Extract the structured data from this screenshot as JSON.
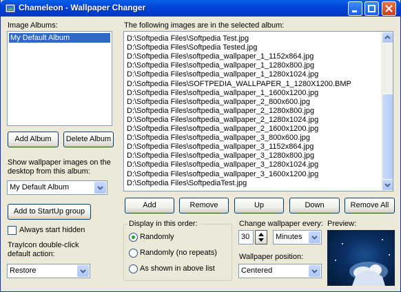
{
  "window": {
    "title": "Chameleon - Wallpaper Changer"
  },
  "left": {
    "albums_label": "Image Albums:",
    "albums": [
      "My Default Album"
    ],
    "add_album": "Add Album",
    "delete_album": "Delete Album",
    "show_label_1": "Show wallpaper images on the",
    "show_label_2": "desktop from this album:",
    "album_select": "My Default Album",
    "startup_btn": "Add to StartUp group",
    "always_hidden": "Always start hidden",
    "trayicon_label_1": "TrayIcon double-click",
    "trayicon_label_2": "default action:",
    "tray_action": "Restore"
  },
  "images": {
    "label": "The following images are in the selected album:",
    "files": [
      "D:\\Softpedia Files\\Softpedia Test.jpg",
      "D:\\Softpedia Files\\Softpedia Tested.jpg",
      "D:\\Softpedia Files\\softpedia_wallpaper_1_1152x864.jpg",
      "D:\\Softpedia Files\\softpedia_wallpaper_1_1280x800.jpg",
      "D:\\Softpedia Files\\softpedia_wallpaper_1_1280x1024.jpg",
      "D:\\Softpedia Files\\SOFTPEDIA_WALLPAPER_1_1280X1200.BMP",
      "D:\\Softpedia Files\\softpedia_wallpaper_1_1600x1200.jpg",
      "D:\\Softpedia Files\\softpedia_wallpaper_2_800x600.jpg",
      "D:\\Softpedia Files\\softpedia_wallpaper_2_1280x800.jpg",
      "D:\\Softpedia Files\\softpedia_wallpaper_2_1280x1024.jpg",
      "D:\\Softpedia Files\\softpedia_wallpaper_2_1600x1200.jpg",
      "D:\\Softpedia Files\\softpedia_wallpaper_3_800x600.jpg",
      "D:\\Softpedia Files\\softpedia_wallpaper_3_1152x864.jpg",
      "D:\\Softpedia Files\\softpedia_wallpaper_3_1280x800.jpg",
      "D:\\Softpedia Files\\softpedia_wallpaper_3_1280x1024.jpg",
      "D:\\Softpedia Files\\softpedia_wallpaper_3_1600x1200.jpg",
      "D:\\Softpedia Files\\SoftpediaTest.jpg"
    ],
    "add": "Add",
    "remove": "Remove",
    "up": "Up",
    "down": "Down",
    "remove_all": "Remove All"
  },
  "order": {
    "label": "Display in this order:",
    "options": [
      "Randomly",
      "Randomly (no repeats)",
      "As shown in above list"
    ],
    "selected": 0
  },
  "change": {
    "label": "Change wallpaper every:",
    "value": "30",
    "unit": "Minutes",
    "position_label": "Wallpaper position:",
    "position": "Centered",
    "preview_label": "Preview:"
  },
  "colors": {
    "titlebar": "#0144d8",
    "accent": "#316ac5",
    "face": "#ece9d8"
  }
}
